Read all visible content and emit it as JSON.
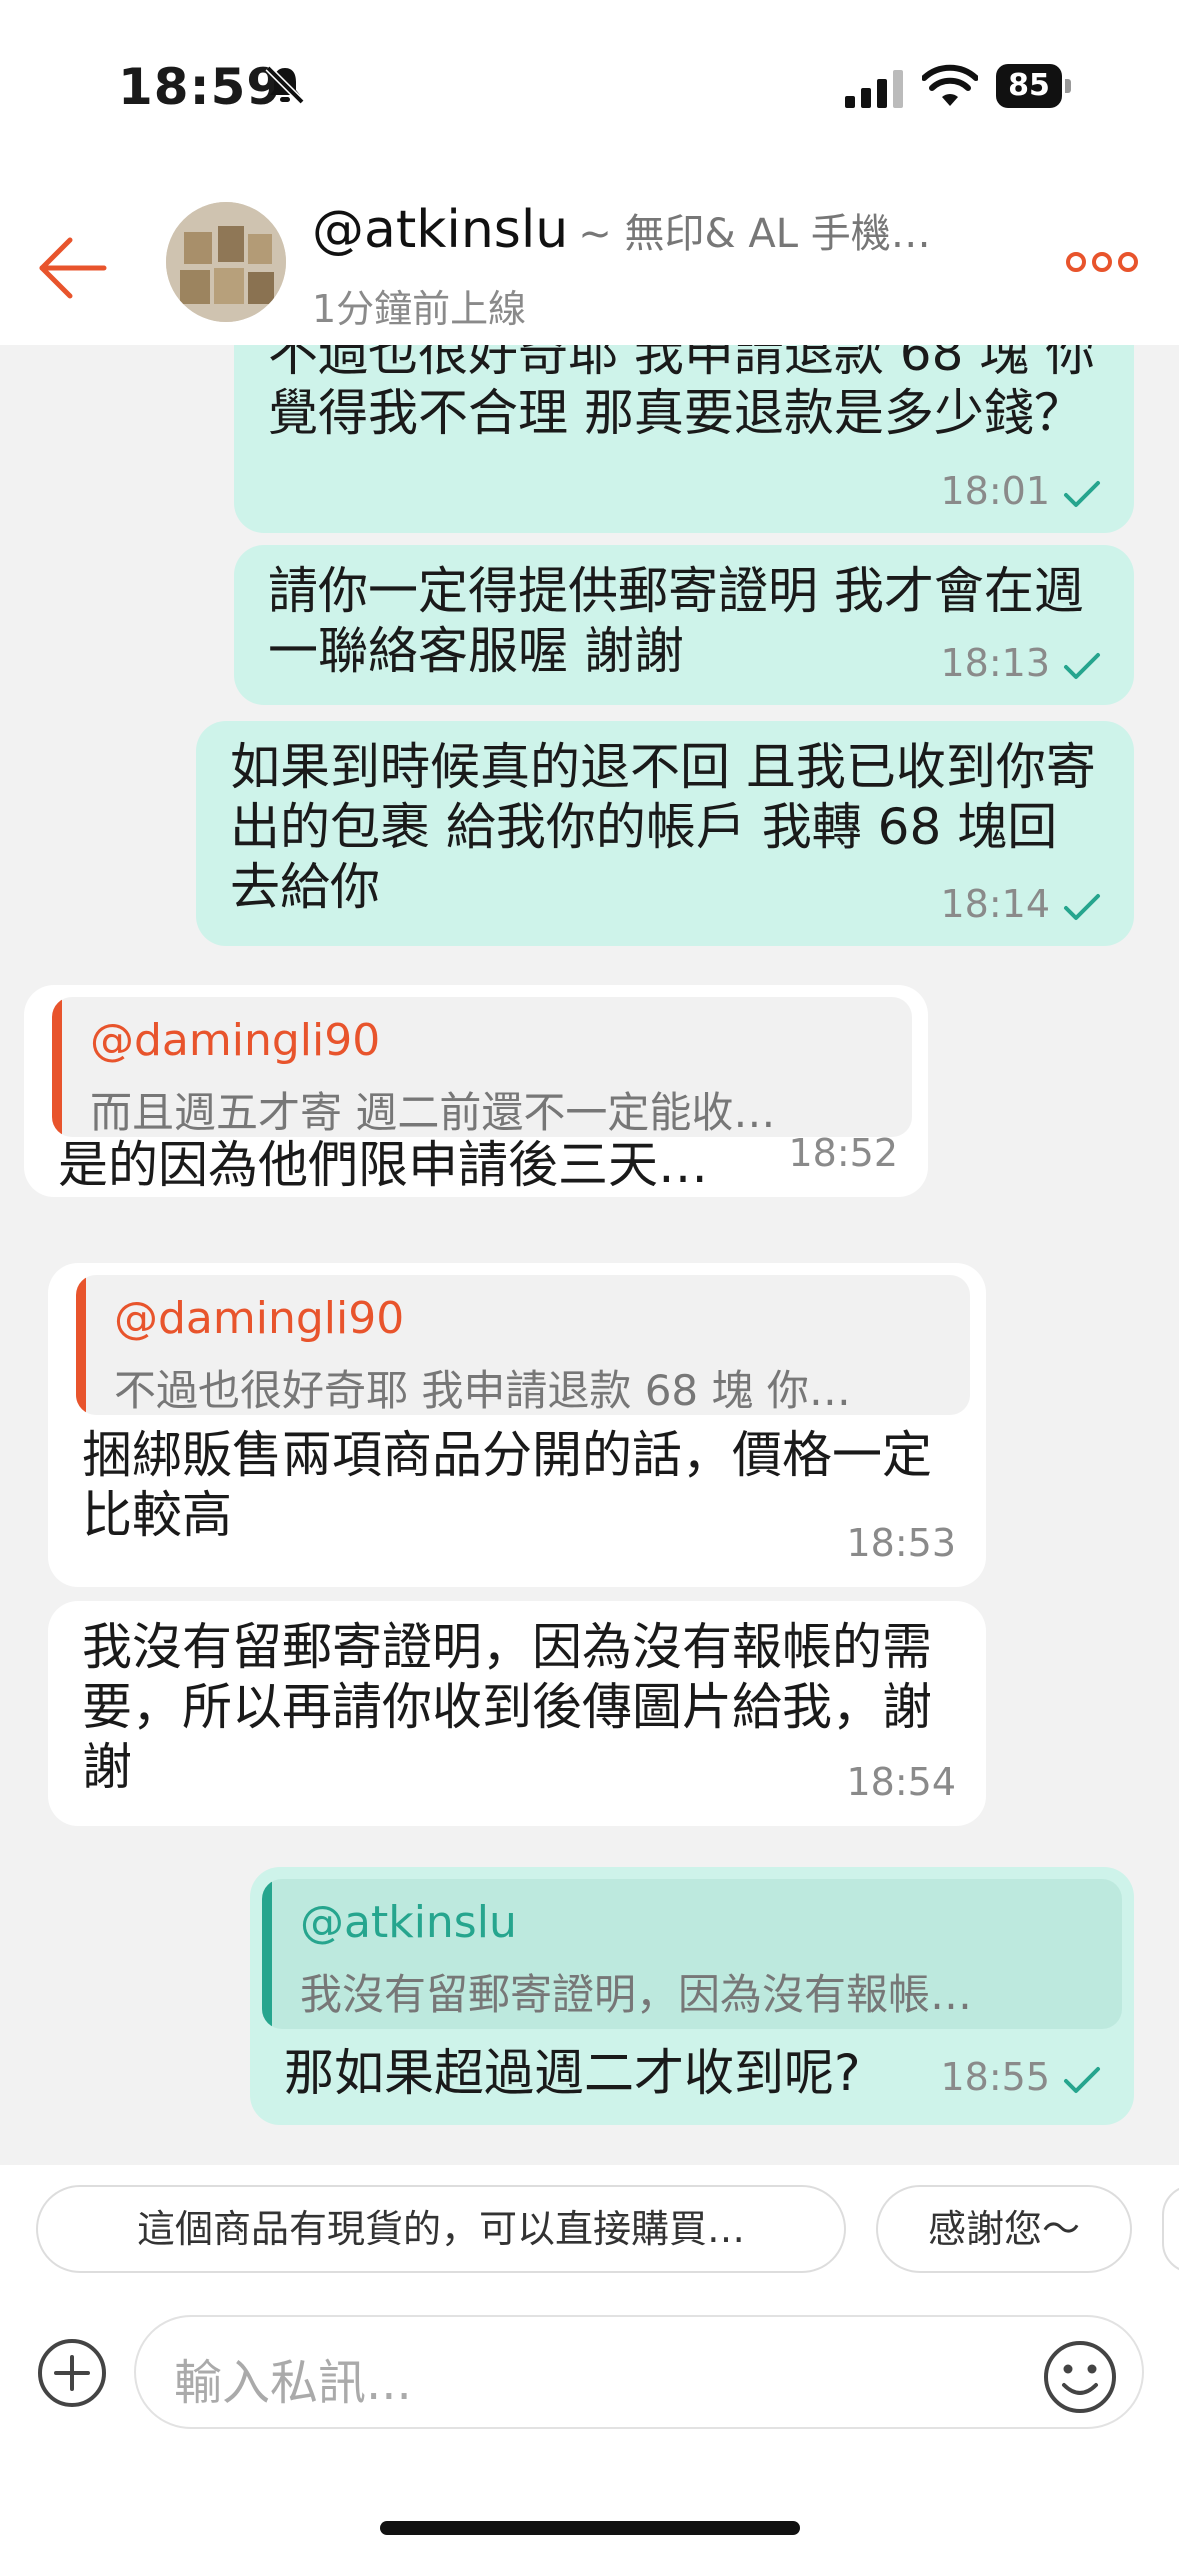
{
  "status_bar": {
    "time": "18:59",
    "battery": "85"
  },
  "header": {
    "username": "@atkinslu",
    "subtitle": "~ 無印& AL 手機…",
    "presence": "1分鐘前上線"
  },
  "messages": [
    {
      "direction": "out",
      "text": "不過也很好奇耶 我申請退款 68 塊 你覺得我不合理 那真要退款是多少錢？",
      "time": "18:01"
    },
    {
      "direction": "out",
      "text": "請你一定得提供郵寄證明 我才會在週一聯絡客服喔 謝謝",
      "time": "18:13"
    },
    {
      "direction": "out",
      "text": "如果到時候真的退不回 且我已收到你寄出的包裹 給我你的帳戶 我轉 68 塊回去給你",
      "time": "18:14"
    },
    {
      "direction": "in",
      "quote": {
        "name": "@damingli90",
        "text": "而且週五才寄 週二前還不一定能收…"
      },
      "text": "是的因為他們限申請後三天…",
      "time": "18:52"
    },
    {
      "direction": "in",
      "quote": {
        "name": "@damingli90",
        "text": "不過也很好奇耶 我申請退款 68 塊 你…"
      },
      "text": "捆綁販售兩項商品分開的話，價格一定比較高",
      "time": "18:53"
    },
    {
      "direction": "in",
      "text": "我沒有留郵寄證明，因為沒有報帳的需要，所以再請你收到後傳圖片給我，謝謝",
      "time": "18:54"
    },
    {
      "direction": "out",
      "quote": {
        "name": "@atkinslu",
        "text": "我沒有留郵寄證明，因為沒有報帳…"
      },
      "text": "那如果超過週二才收到呢?",
      "time": "18:55"
    }
  ],
  "quick_replies": [
    "這個商品有現貨的，可以直接購買…",
    "感謝您～"
  ],
  "composer": {
    "placeholder": "輸入私訊..."
  },
  "colors": {
    "accent": "#e8542c",
    "out_bubble": "#cef3ea",
    "tick": "#26a58e"
  }
}
